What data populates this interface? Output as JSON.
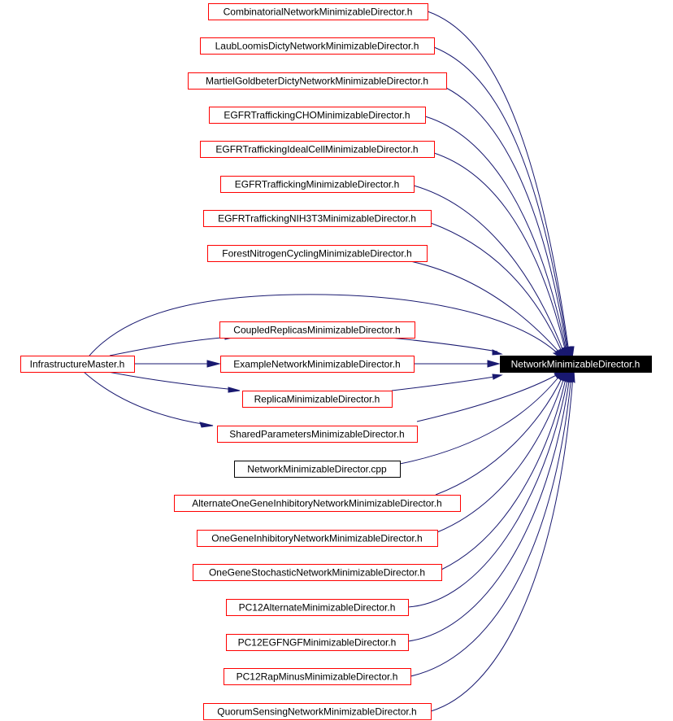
{
  "graph": {
    "type": "include-dependency-graph",
    "colors": {
      "edge": "#191970",
      "node_border": "#ff0000",
      "plain_border": "#000000",
      "focus_fill": "#000000",
      "focus_text": "#ffffff"
    },
    "focus_node": "NetworkMinimizableDirector.h",
    "nodes": [
      {
        "id": "combinatorial",
        "label": "CombinatorialNetworkMinimizableDirector.h",
        "style": "link"
      },
      {
        "id": "laubloomis",
        "label": "LaubLoomisDictyNetworkMinimizableDirector.h",
        "style": "link"
      },
      {
        "id": "martiel",
        "label": "MartielGoldbeterDictyNetworkMinimizableDirector.h",
        "style": "link"
      },
      {
        "id": "egfr_cho",
        "label": "EGFRTraffickingCHOMinimizableDirector.h",
        "style": "link"
      },
      {
        "id": "egfr_ideal",
        "label": "EGFRTraffickingIdealCellMinimizableDirector.h",
        "style": "link"
      },
      {
        "id": "egfr",
        "label": "EGFRTraffickingMinimizableDirector.h",
        "style": "link"
      },
      {
        "id": "egfr_nih",
        "label": "EGFRTraffickingNIH3T3MinimizableDirector.h",
        "style": "link"
      },
      {
        "id": "forest",
        "label": "ForestNitrogenCyclingMinimizableDirector.h",
        "style": "link"
      },
      {
        "id": "infra",
        "label": "InfrastructureMaster.h",
        "style": "link"
      },
      {
        "id": "coupled",
        "label": "CoupledReplicasMinimizableDirector.h",
        "style": "link"
      },
      {
        "id": "example",
        "label": "ExampleNetworkMinimizableDirector.h",
        "style": "link"
      },
      {
        "id": "replica",
        "label": "ReplicaMinimizableDirector.h",
        "style": "link"
      },
      {
        "id": "shared",
        "label": "SharedParametersMinimizableDirector.h",
        "style": "link"
      },
      {
        "id": "nmd_cpp",
        "label": "NetworkMinimizableDirector.cpp",
        "style": "plain"
      },
      {
        "id": "alt_onegene",
        "label": "AlternateOneGeneInhibitoryNetworkMinimizableDirector.h",
        "style": "link"
      },
      {
        "id": "onegene_inh",
        "label": "OneGeneInhibitoryNetworkMinimizableDirector.h",
        "style": "link"
      },
      {
        "id": "onegene_sto",
        "label": "OneGeneStochasticNetworkMinimizableDirector.h",
        "style": "link"
      },
      {
        "id": "pc12_alt",
        "label": "PC12AlternateMinimizableDirector.h",
        "style": "link"
      },
      {
        "id": "pc12_egf",
        "label": "PC12EGFNGFMinimizableDirector.h",
        "style": "link"
      },
      {
        "id": "pc12_rap",
        "label": "PC12RapMinusMinimizableDirector.h",
        "style": "link"
      },
      {
        "id": "quorum",
        "label": "QuorumSensingNetworkMinimizableDirector.h",
        "style": "link"
      },
      {
        "id": "focus",
        "label": "NetworkMinimizableDirector.h",
        "style": "focus"
      }
    ],
    "edges": [
      {
        "from": "combinatorial",
        "to": "focus"
      },
      {
        "from": "laubloomis",
        "to": "focus"
      },
      {
        "from": "martiel",
        "to": "focus"
      },
      {
        "from": "egfr_cho",
        "to": "focus"
      },
      {
        "from": "egfr_ideal",
        "to": "focus"
      },
      {
        "from": "egfr",
        "to": "focus"
      },
      {
        "from": "egfr_nih",
        "to": "focus"
      },
      {
        "from": "forest",
        "to": "focus"
      },
      {
        "from": "infra",
        "to": "focus"
      },
      {
        "from": "infra",
        "to": "coupled"
      },
      {
        "from": "infra",
        "to": "example"
      },
      {
        "from": "infra",
        "to": "replica"
      },
      {
        "from": "infra",
        "to": "shared"
      },
      {
        "from": "coupled",
        "to": "focus"
      },
      {
        "from": "example",
        "to": "focus"
      },
      {
        "from": "replica",
        "to": "focus"
      },
      {
        "from": "shared",
        "to": "focus"
      },
      {
        "from": "nmd_cpp",
        "to": "focus"
      },
      {
        "from": "alt_onegene",
        "to": "focus"
      },
      {
        "from": "onegene_inh",
        "to": "focus"
      },
      {
        "from": "onegene_sto",
        "to": "focus"
      },
      {
        "from": "pc12_alt",
        "to": "focus"
      },
      {
        "from": "pc12_egf",
        "to": "focus"
      },
      {
        "from": "pc12_rap",
        "to": "focus"
      },
      {
        "from": "quorum",
        "to": "focus"
      }
    ]
  }
}
